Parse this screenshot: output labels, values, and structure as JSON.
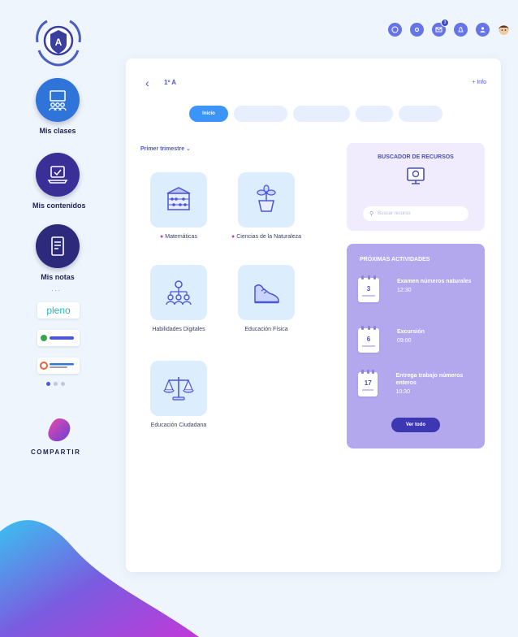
{
  "sidebar": {
    "items": [
      {
        "label": "Mis clases",
        "color": "#2f74d8"
      },
      {
        "label": "Mis contenidos",
        "color": "#3a2f96"
      },
      {
        "label": "Mis notas",
        "color": "#2d2a7c"
      }
    ],
    "more_dots": "···",
    "partners": [
      "pleno",
      "",
      ""
    ],
    "brand": "COMPARTIR"
  },
  "header": {
    "class_title": "1º A",
    "info_link": "+ Info",
    "notification_count": "3"
  },
  "tabs": [
    "Inicio",
    "",
    "",
    "",
    ""
  ],
  "period_select": "Primer trimestre",
  "subjects": [
    {
      "name": "Matemáticas",
      "marked": true,
      "icon": "abacus-icon"
    },
    {
      "name": "Ciencias de la Naturaleza",
      "marked": true,
      "icon": "plant-icon"
    },
    {
      "name": "Habilidades Digitales",
      "marked": false,
      "icon": "network-icon"
    },
    {
      "name": "Educación Física",
      "marked": false,
      "icon": "sneaker-icon"
    },
    {
      "name": "Educación Ciudadana",
      "marked": false,
      "icon": "scales-icon"
    }
  ],
  "resource_search": {
    "title": "BUSCADOR DE RECURSOS",
    "placeholder": "Buscar recurso"
  },
  "activities": {
    "title": "PRÓXIMAS ACTIVIDADES",
    "items": [
      {
        "day": "3",
        "title": "Examen números naturales",
        "time": "12:30"
      },
      {
        "day": "6",
        "title": "Excursión",
        "time": "09:00"
      },
      {
        "day": "17",
        "title": "Entrega trabajo números enteros",
        "time": "10:30"
      }
    ],
    "see_all": "Ver todo"
  },
  "colors": {
    "accent": "#4a57d6",
    "tab_active": "#3c95f6",
    "activities_bg": "#b3a7ee",
    "search_panel_bg": "#f0ecfd",
    "subject_tile": "#dcedfe"
  }
}
